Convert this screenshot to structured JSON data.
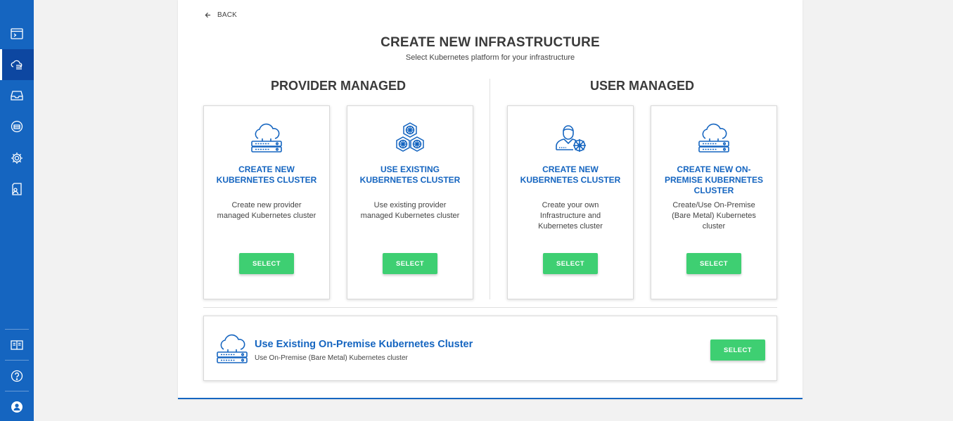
{
  "sidebar": {
    "items": [
      {
        "icon": "terminal-folder-icon"
      },
      {
        "icon": "cloud-list-icon",
        "active": true
      },
      {
        "icon": "inbox-icon"
      },
      {
        "icon": "hub-icon"
      },
      {
        "icon": "gear-icon"
      },
      {
        "icon": "document-person-icon"
      },
      {
        "icon": "book-icon"
      },
      {
        "icon": "help-icon"
      },
      {
        "icon": "user-icon"
      }
    ],
    "color": "#1565c0",
    "active_color": "#0d47a1"
  },
  "back_label": "BACK",
  "page_title": "CREATE NEW INFRASTRUCTURE",
  "page_subtitle": "Select Kubernetes platform for your infrastructure",
  "sections": {
    "provider_title": "PROVIDER MANAGED",
    "user_title": "USER MANAGED"
  },
  "cards": [
    {
      "icon": "cloud-server-icon",
      "title": "CREATE NEW\nKUBERNETES CLUSTER",
      "description": "Create new provider\nmanaged Kubernetes cluster",
      "button": "SELECT"
    },
    {
      "icon": "kubernetes-cluster-icon",
      "title": "USE EXISTING\nKUBERNETES CLUSTER",
      "description": "Use existing provider\nmanaged Kubernetes cluster",
      "button": "SELECT"
    },
    {
      "icon": "user-kubernetes-icon",
      "title": "CREATE NEW\nKUBERNETES CLUSTER",
      "description": "Create your own\nInfrastructure and\nKubernetes cluster",
      "button": "SELECT"
    },
    {
      "icon": "cloud-server-icon",
      "title": "CREATE NEW ON-\nPREMISE KUBERNETES\nCLUSTER",
      "description": "Create/Use On-Premise\n(Bare Metal) Kubernetes\ncluster",
      "button": "SELECT"
    }
  ],
  "existing_onprem": {
    "icon": "cloud-server-icon",
    "title": "Use Existing On-Premise Kubernetes Cluster",
    "description": "Use On-Premise (Bare Metal) Kubernetes cluster",
    "button": "SELECT"
  },
  "colors": {
    "accent": "#1565c0",
    "button": "#3ecf72",
    "background": "#f2f2f2"
  }
}
